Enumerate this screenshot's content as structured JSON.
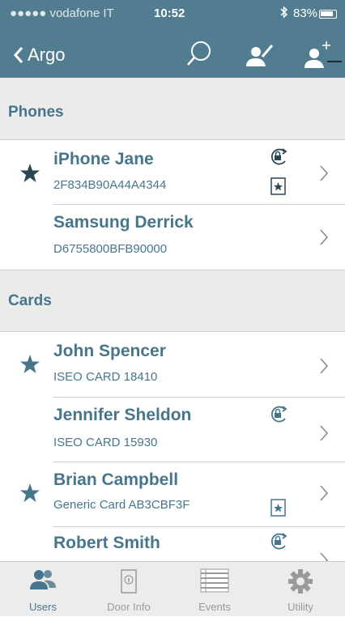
{
  "status_bar": {
    "carrier": "●●●●● vodafone IT",
    "time": "10:52",
    "battery": "83%"
  },
  "nav": {
    "back_label": "Argo",
    "icons": [
      "search-icon",
      "user-edit-icon",
      "user-add-icon"
    ]
  },
  "colors": {
    "header": "#527c8f",
    "accent": "#47768c",
    "section_bg": "#ebebeb"
  },
  "sections": [
    {
      "title": "Phones",
      "items": [
        {
          "name": "iPhone Jane",
          "code": "2F834B90A44A4344",
          "starred": true,
          "lock": true,
          "badge": true
        },
        {
          "name": "Samsung Derrick",
          "code": "D6755800BFB90000",
          "starred": false,
          "lock": false,
          "badge": false
        }
      ]
    },
    {
      "title": "Cards",
      "items": [
        {
          "name": "John Spencer",
          "code": "ISEO CARD 18410",
          "starred": true,
          "lock": false,
          "badge": false
        },
        {
          "name": "Jennifer Sheldon",
          "code": "ISEO CARD 15930",
          "starred": false,
          "lock": true,
          "badge": false
        },
        {
          "name": "Brian Campbell",
          "code": "Generic Card AB3CBF3F",
          "starred": true,
          "lock": false,
          "badge": true
        },
        {
          "name": "Robert Smith",
          "code": "",
          "starred": false,
          "lock": true,
          "badge": false
        }
      ]
    }
  ],
  "tabs": [
    {
      "label": "Users",
      "icon": "users-icon",
      "active": true
    },
    {
      "label": "Door Info",
      "icon": "door-icon",
      "active": false
    },
    {
      "label": "Events",
      "icon": "events-list-icon",
      "active": false
    },
    {
      "label": "Utility",
      "icon": "gear-icon",
      "active": false
    }
  ]
}
